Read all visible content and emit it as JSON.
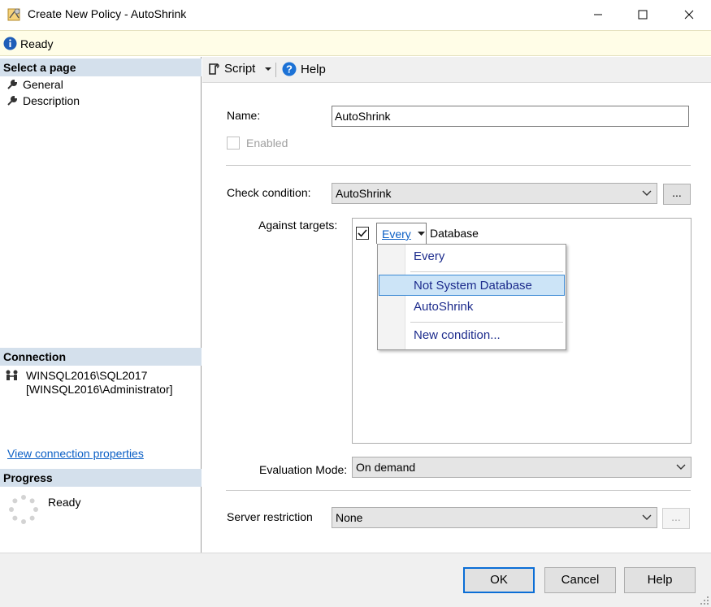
{
  "window": {
    "title": "Create New Policy - AutoShrink",
    "minimize_icon": "minimize-icon",
    "maximize_icon": "maximize-icon",
    "close_icon": "close-icon"
  },
  "status": {
    "text": "Ready",
    "icon": "info-icon"
  },
  "sidebar": {
    "select_page_header": "Select a page",
    "pages": [
      {
        "label": "General",
        "icon": "wrench-icon"
      },
      {
        "label": "Description",
        "icon": "wrench-icon"
      }
    ],
    "connection_header": "Connection",
    "connection_server": "WINSQL2016\\SQL2017",
    "connection_user": "[WINSQL2016\\Administrator]",
    "view_connection_link": "View connection properties",
    "progress_header": "Progress",
    "progress_status": "Ready"
  },
  "toolbar": {
    "script_label": "Script",
    "help_label": "Help"
  },
  "form": {
    "name_label": "Name:",
    "name_value": "AutoShrink",
    "enabled_label": "Enabled",
    "enabled_checked": false,
    "check_condition_label": "Check condition:",
    "check_condition_value": "AutoShrink",
    "ellipsis": "...",
    "against_targets_label": "Against targets:",
    "target_checked": true,
    "target_selector_value": "Every",
    "target_type": "Database",
    "evaluation_mode_label": "Evaluation Mode:",
    "evaluation_mode_value": "On demand",
    "server_restriction_label": "Server restriction",
    "server_restriction_value": "None"
  },
  "target_dropdown": {
    "items": [
      "Every",
      "Not System Database",
      "AutoShrink",
      "New condition..."
    ],
    "selected": "Not System Database"
  },
  "buttons": {
    "ok": "OK",
    "cancel": "Cancel",
    "help": "Help"
  },
  "colors": {
    "header_bg": "#d4e0ec",
    "status_bg": "#fffde7",
    "accent": "#0b6ed6",
    "link": "#0b5fc5"
  }
}
